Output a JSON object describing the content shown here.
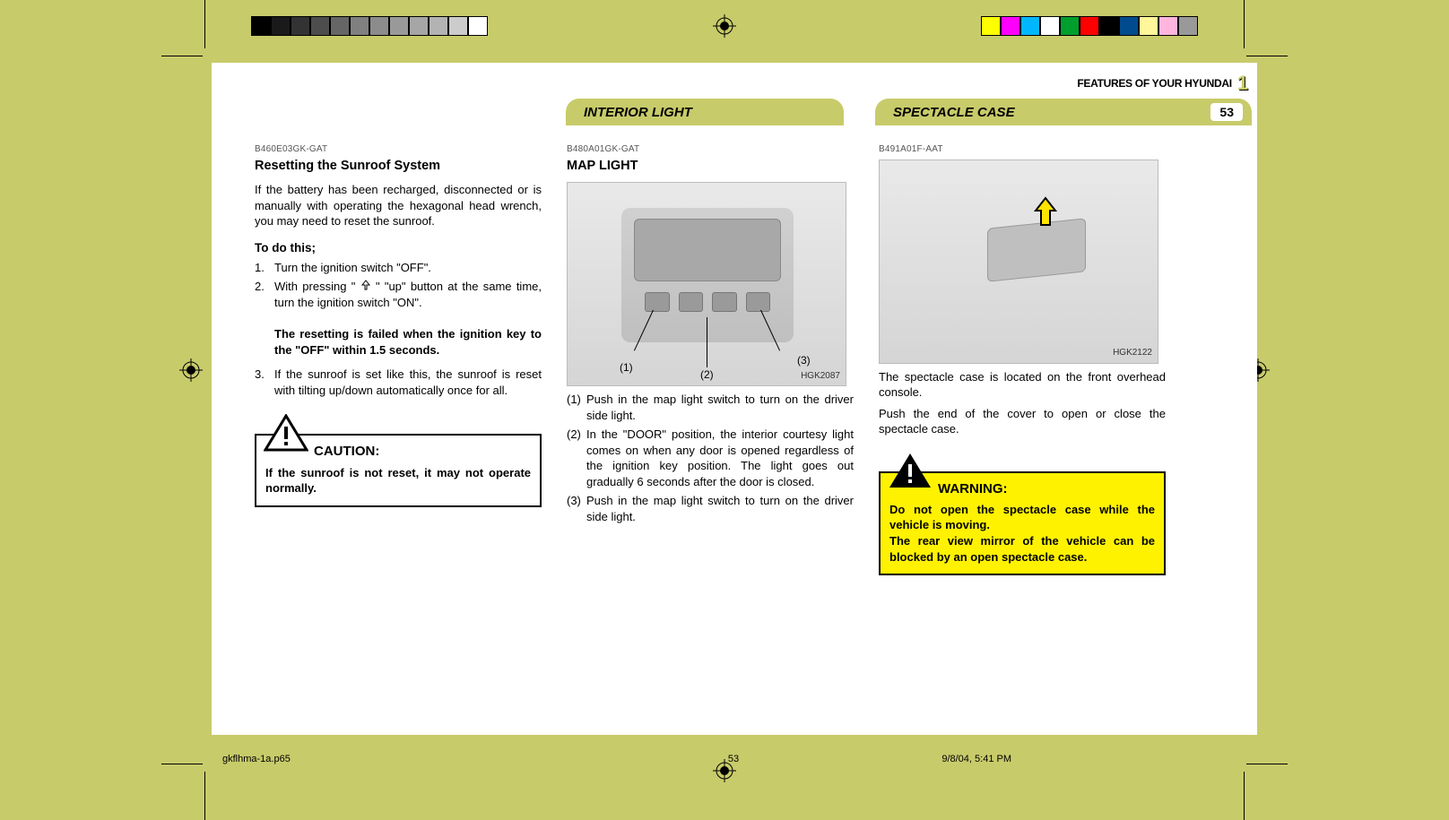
{
  "header": {
    "breadcrumb": "FEATURES OF YOUR HYUNDAI",
    "chapter": "1",
    "page_number": "53"
  },
  "pills": {
    "interior_light": "INTERIOR LIGHT",
    "spectacle_case": "SPECTACLE CASE"
  },
  "col1": {
    "code": "B460E03GK-GAT",
    "title": "Resetting the Sunroof System",
    "p1": "If the battery has been recharged, disconnected or is manually with operating the hexagonal head wrench, you may need to reset the sunroof.",
    "todo_label": "To do this;",
    "step1": "Turn the ignition switch \"OFF\".",
    "step2a": "With pressing \"",
    "step2b": "\" \"up\" button at the same time, turn the ignition switch \"ON\".",
    "step2_note": "The resetting is failed when the ignition key to the \"OFF\" within 1.5 seconds.",
    "step3": "If the sunroof is set like this, the sunroof is reset with tilting up/down automatically once for all.",
    "caution_label": "CAUTION:",
    "caution_text": "If the sunroof is not reset, it may not operate normally."
  },
  "col2": {
    "code": "B480A01GK-GAT",
    "title": "MAP LIGHT",
    "fig_code": "HGK2087",
    "lbl1": "(1)",
    "lbl2": "(2)",
    "lbl3": "(3)",
    "item1": "Push in the map light switch to turn on the driver side light.",
    "item2": "In the \"DOOR\" position, the interior courtesy light comes on when any door is opened regardless of the ignition key position. The light goes out gradually 6 seconds after the door is closed.",
    "item3": "Push in the map light switch to turn on the driver side light."
  },
  "col3": {
    "code": "B491A01F-AAT",
    "fig_code": "HGK2122",
    "p1": "The spectacle case is located on the front overhead console.",
    "p2": "Push the end of the cover to open or close the spectacle case.",
    "warning_label": "WARNING:",
    "warning_text1": "Do not open the spectacle case while the vehicle is moving.",
    "warning_text2": "The rear view mirror of the vehicle can be blocked by an open spectacle case."
  },
  "footer": {
    "file": "gkflhma-1a.p65",
    "page": "53",
    "timestamp": "9/8/04, 5:41 PM"
  },
  "colorbar_left": [
    "#000000",
    "#1a1a1a",
    "#333333",
    "#4d4d4d",
    "#666666",
    "#808080",
    "#8c8c8c",
    "#999999",
    "#a6a6a6",
    "#b3b3b3",
    "#cccccc",
    "#ffffff"
  ],
  "colorbar_right": [
    "#ffff00",
    "#ff00ff",
    "#00b7ff",
    "#ffffff",
    "#009e2d",
    "#ff0000",
    "#000000",
    "#004b8d",
    "#fff79a",
    "#ffb5de",
    "#999999"
  ]
}
